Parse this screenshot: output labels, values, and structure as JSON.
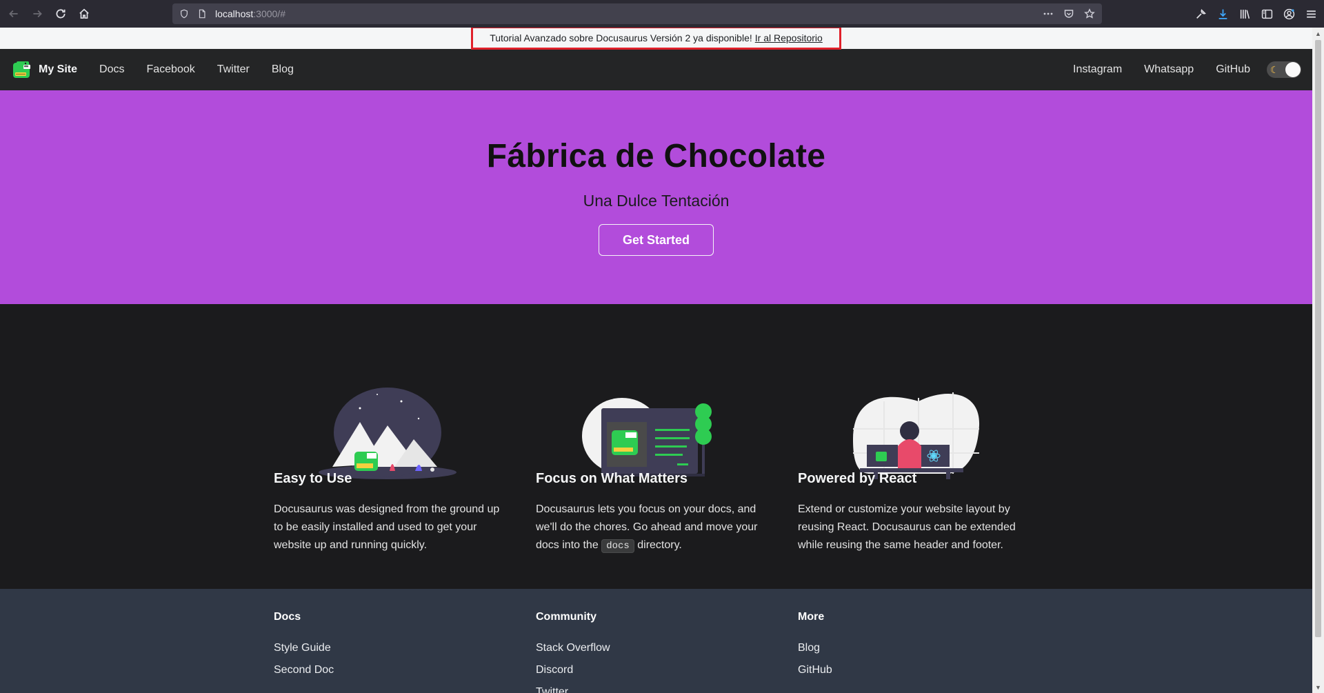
{
  "browser": {
    "url_host": "localhost",
    "url_path": ":3000/#",
    "icons": [
      "back-icon",
      "forward-icon",
      "reload-icon",
      "home-icon",
      "shield-icon",
      "page-icon",
      "more-icon",
      "pocket-icon",
      "bookmark-star-icon",
      "wrench-icon",
      "download-icon",
      "library-icon",
      "sidebar-icon",
      "account-icon",
      "menu-icon"
    ]
  },
  "announcement": {
    "text": "Tutorial Avanzado sobre Docusaurus Versión 2 ya disponible!",
    "link": "Ir al Repositorio"
  },
  "navbar": {
    "brand": "My Site",
    "left": [
      "Docs",
      "Facebook",
      "Twitter",
      "Blog"
    ],
    "right": [
      "Instagram",
      "Whatsapp",
      "GitHub"
    ],
    "theme_toggle_icon": "moon-icon"
  },
  "hero": {
    "title": "Fábrica de Chocolate",
    "tagline": "Una Dulce Tentación",
    "cta": "Get Started"
  },
  "features": [
    {
      "title": "Easy to Use",
      "text": "Docusaurus was designed from the ground up to be easily installed and used to get your website up and running quickly.",
      "illustration": "mountain-dinosaur-illustration"
    },
    {
      "title": "Focus on What Matters",
      "text_before": "Docusaurus lets you focus on your docs, and we'll do the chores. Go ahead and move your docs into the",
      "code": "docs",
      "text_after": "directory.",
      "illustration": "monitor-tree-illustration"
    },
    {
      "title": "Powered by React",
      "text": "Extend or customize your website layout by reusing React. Docusaurus can be extended while reusing the same header and footer.",
      "illustration": "person-desk-react-illustration"
    }
  ],
  "footer": {
    "columns": [
      {
        "title": "Docs",
        "links": [
          "Style Guide",
          "Second Doc"
        ]
      },
      {
        "title": "Community",
        "links": [
          "Stack Overflow",
          "Discord",
          "Twitter"
        ]
      },
      {
        "title": "More",
        "links": [
          "Blog",
          "GitHub"
        ]
      }
    ]
  },
  "colors": {
    "hero_bg": "#b24cdb",
    "navbar_bg": "#242526",
    "page_bg": "#1b1b1d",
    "footer_bg": "#303846",
    "announcement_highlight": "#e0202a"
  }
}
